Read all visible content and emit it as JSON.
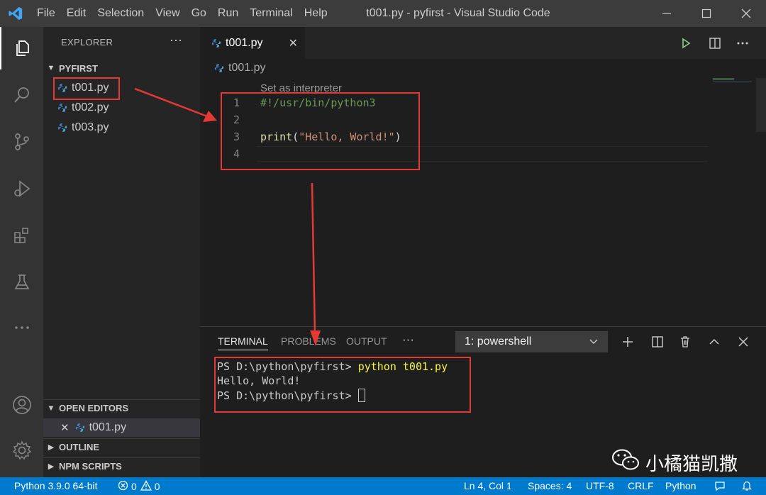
{
  "menubar": {
    "items": [
      "File",
      "Edit",
      "Selection",
      "View",
      "Go",
      "Run",
      "Terminal",
      "Help"
    ],
    "window_title": "t001.py - pyfirst - Visual Studio Code"
  },
  "activity_bar": {
    "icons": [
      "explorer-icon",
      "search-icon",
      "source-control-icon",
      "run-debug-icon",
      "extensions-icon",
      "testing-icon",
      "more-icon",
      "account-icon",
      "settings-gear-icon"
    ]
  },
  "sidebar": {
    "title": "EXPLORER",
    "more": "···",
    "folder": "PYFIRST",
    "files": [
      "t001.py",
      "t002.py",
      "t003.py"
    ],
    "open_editors_title": "OPEN EDITORS",
    "open_editors": [
      "t001.py"
    ],
    "outline_title": "OUTLINE",
    "npm_title": "NPM SCRIPTS"
  },
  "editor": {
    "tab_label": "t001.py",
    "tab_close": "✕",
    "breadcrumb": "t001.py",
    "codelens": "Set as interpreter",
    "lines": [
      {
        "num": "1",
        "text": "#!/usr/bin/python3"
      },
      {
        "num": "2",
        "text": ""
      },
      {
        "num": "3",
        "text": "print(\"Hello, World!\")"
      },
      {
        "num": "4",
        "text": ""
      }
    ]
  },
  "panel": {
    "tabs": [
      "TERMINAL",
      "PROBLEMS",
      "OUTPUT"
    ],
    "more": "···",
    "terminal_select": "1: powershell",
    "terminal_lines": [
      {
        "prompt": "PS D:\\python\\pyfirst> ",
        "cmd": "python t001.py"
      },
      {
        "output": "Hello, World!"
      },
      {
        "prompt": "PS D:\\python\\pyfirst> ",
        "cmd": ""
      }
    ]
  },
  "statusbar": {
    "interpreter": "Python 3.9.0 64-bit",
    "errors": "0",
    "warnings": "0",
    "position": "Ln 4, Col 1",
    "spaces": "Spaces: 4",
    "encoding": "UTF-8",
    "eol": "CRLF",
    "language": "Python"
  },
  "watermark": {
    "text": "小橘猫凯撒"
  },
  "colors": {
    "accent": "#007acc",
    "annotation_red": "#e53935",
    "keyword_yellow": "#dcdcaa",
    "string_orange": "#ce9178",
    "comment_green": "#6a9955"
  }
}
